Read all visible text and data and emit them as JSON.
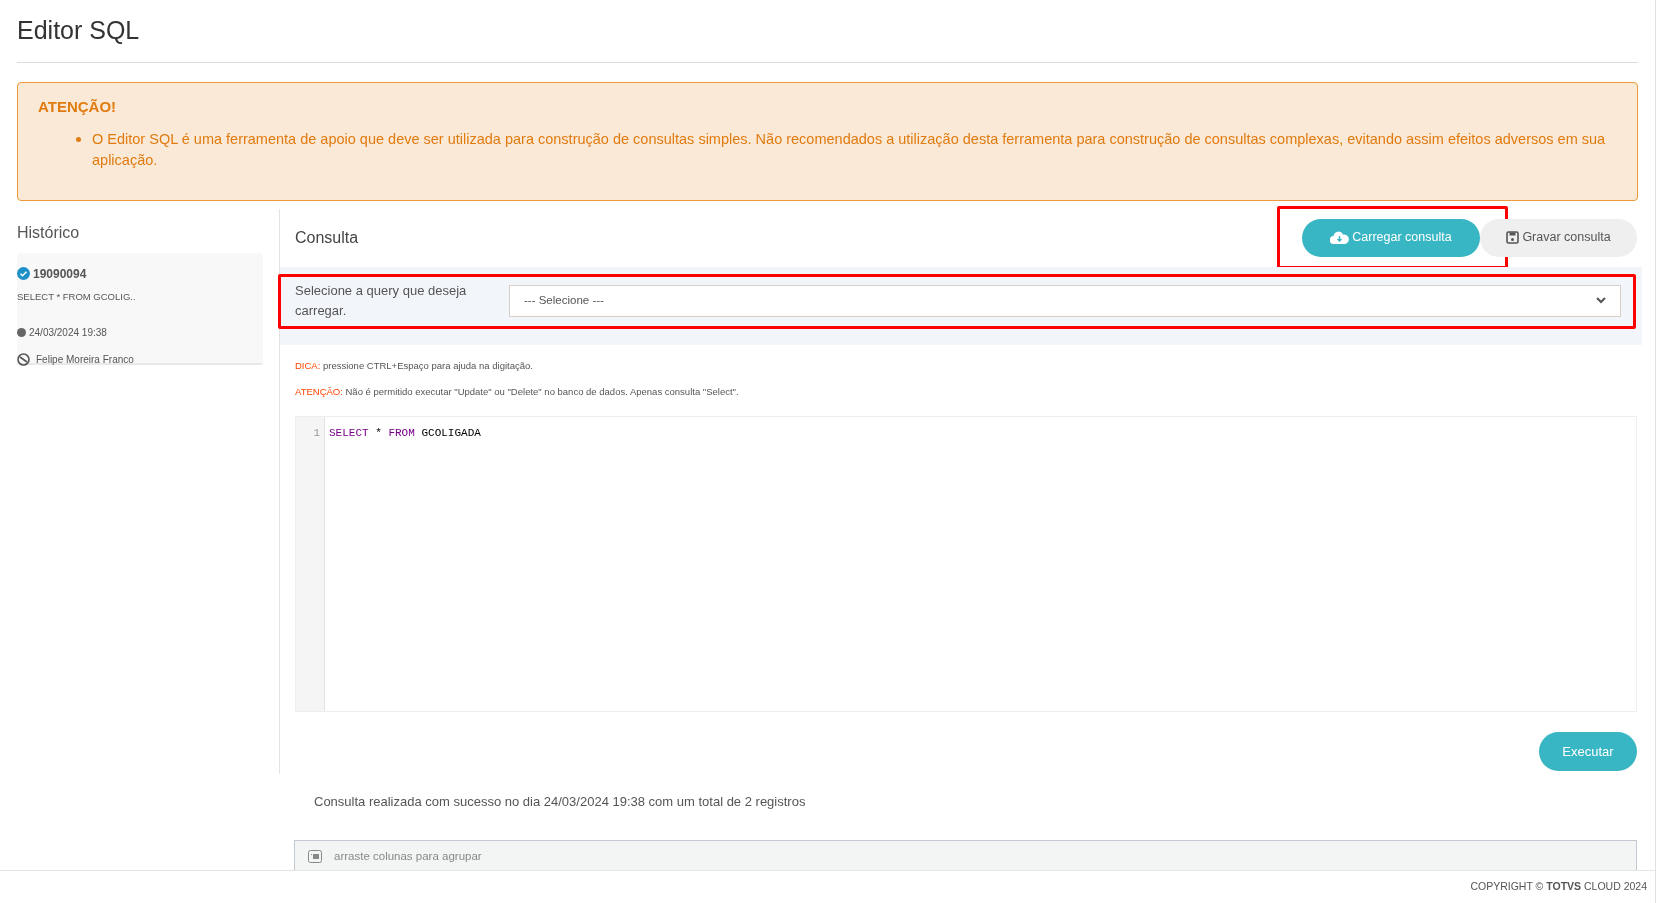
{
  "page_title": "Editor SQL",
  "alert": {
    "title": "ATENÇÃO!",
    "items": [
      "O Editor SQL é uma ferramenta de apoio que deve ser utilizada para construção de consultas simples. Não recomendados a utilização desta ferramenta para construção de consultas complexas, evitando assim efeitos adversos em sua aplicação."
    ]
  },
  "history": {
    "title": "Histórico",
    "entries": [
      {
        "id": "19090094",
        "query": "SELECT * FROM GCOLIG..",
        "date": "24/03/2024 19:38",
        "user": "Felipe Moreira Franco"
      }
    ]
  },
  "query_panel": {
    "title": "Consulta",
    "buttons": [
      {
        "label": "Carregar consulta",
        "kind": "primary",
        "highlighted": true
      },
      {
        "label": "Gravar consulta",
        "kind": "secondary",
        "highlighted": false
      }
    ],
    "select": {
      "label": "Selecione a query que deseja carregar.",
      "value": "--- Selecione ---",
      "highlighted": true
    },
    "hints": [
      {
        "label": "DICA:",
        "text": "pressione CTRL+Espaço para ajuda na digitação."
      },
      {
        "label": "ATENÇÃO:",
        "text": "Não é permitido executar \"Update\" ou \"Delete\" no banco de dados. Apenas consulta \"Select\"."
      }
    ],
    "editor": {
      "lines": [
        {
          "number": "1",
          "tokens": [
            {
              "kind": "keyword",
              "text": "SELECT"
            },
            {
              "kind": "plain",
              "text": " * "
            },
            {
              "kind": "keyword",
              "text": "FROM"
            },
            {
              "kind": "plain",
              "text": " GCOLIGADA"
            }
          ]
        }
      ]
    },
    "execute_button": "Executar"
  },
  "result_message": "Consulta realizada com sucesso no dia 24/03/2024 19:38 com um total de 2 registros",
  "grid": {
    "group_hint": "arraste colunas para agrupar"
  },
  "footer": "COPYRIGHT © **TOTVS** CLOUD 2024"
}
